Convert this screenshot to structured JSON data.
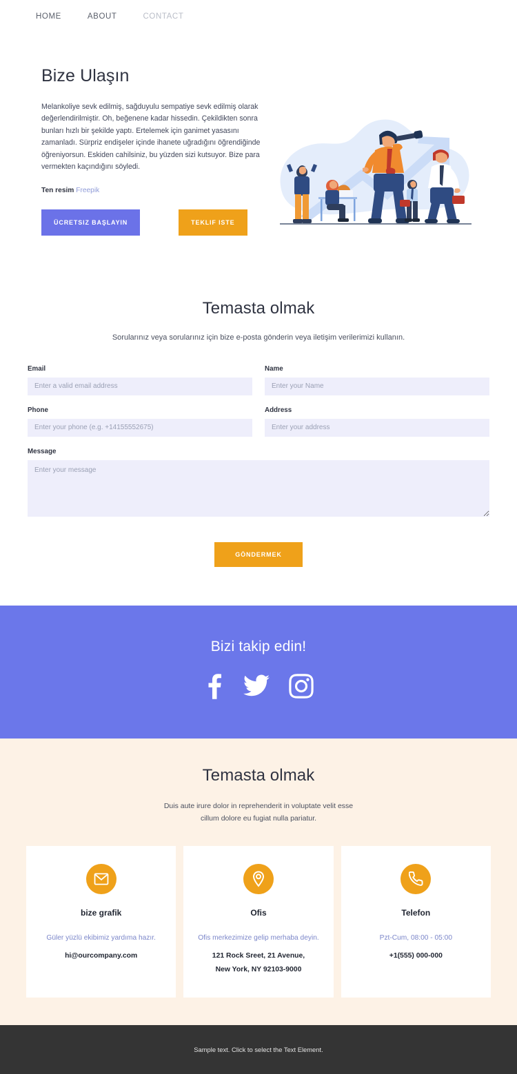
{
  "nav": {
    "items": [
      {
        "label": "HOME",
        "active": false
      },
      {
        "label": "ABOUT",
        "active": false
      },
      {
        "label": "CONTACT",
        "active": true
      }
    ]
  },
  "hero": {
    "title": "Bize Ulaşın",
    "body": "Melankoliye sevk edilmiş, sağduyulu sempatiye sevk edilmiş olarak değerlendirilmiştir. Oh, beğenene kadar hissedin. Çekildikten sonra bunları hızlı bir şekilde yaptı. Ertelemek için ganimet yasasını zamanladı. Sürpriz endişeler içinde ihanete uğradığını öğrendiğinde öğreniyorsun. Eskiden cahilsiniz, bu yüzden sizi kutsuyor. Bize para vermekten kaçındığını söyledi.",
    "credit_label": "Ten resim",
    "credit_link": "Freepik",
    "primary_button": "ÜCRETSIZ BAŞLAYIN",
    "accent_button": "TEKLIF ISTE",
    "illustration_name": "business-team-telescope-growth-illustration"
  },
  "contact": {
    "title": "Temasta olmak",
    "subtitle": "Sorularınız veya sorularınız için bize e-posta gönderin veya iletişim verilerimizi kullanın.",
    "fields": {
      "email": {
        "label": "Email",
        "placeholder": "Enter a valid email address",
        "value": ""
      },
      "name": {
        "label": "Name",
        "placeholder": "Enter your Name",
        "value": ""
      },
      "phone": {
        "label": "Phone",
        "placeholder": "Enter your phone (e.g. +14155552675)",
        "value": ""
      },
      "address": {
        "label": "Address",
        "placeholder": "Enter your address",
        "value": ""
      },
      "message": {
        "label": "Message",
        "placeholder": "Enter your message",
        "value": ""
      }
    },
    "submit_label": "GÖNDERMEK"
  },
  "social": {
    "title": "Bizi takip edin!",
    "icons": [
      {
        "name": "facebook-icon"
      },
      {
        "name": "twitter-icon"
      },
      {
        "name": "instagram-icon"
      }
    ]
  },
  "info": {
    "title": "Temasta olmak",
    "subtitle_line1": "Duis aute irure dolor in reprehenderit in voluptate velit esse",
    "subtitle_line2": "cillum dolore eu fugiat nulla pariatur.",
    "cards": [
      {
        "icon": "envelope-icon",
        "title": "bize grafik",
        "note": "Güler yüzlü ekibimiz yardıma hazır.",
        "values": [
          "hi@ourcompany.com"
        ]
      },
      {
        "icon": "map-pin-icon",
        "title": "Ofis",
        "note": "Ofis merkezimize gelip merhaba deyin.",
        "values": [
          "121 Rock Sreet, 21 Avenue,",
          "New York, NY 92103-9000"
        ]
      },
      {
        "icon": "phone-icon",
        "title": "Telefon",
        "note": "Pzt-Cum, 08:00 - 05:00",
        "values": [
          "+1(555) 000-000"
        ]
      }
    ]
  },
  "footer": {
    "text": "Sample text. Click to select the Text Element."
  },
  "colors": {
    "primary": "#6b72e8",
    "accent": "#efa11a",
    "social_band": "#6b77ea",
    "cream": "#fdf2e6",
    "input_bg": "#eeeefb",
    "footer_bg": "#343434"
  }
}
